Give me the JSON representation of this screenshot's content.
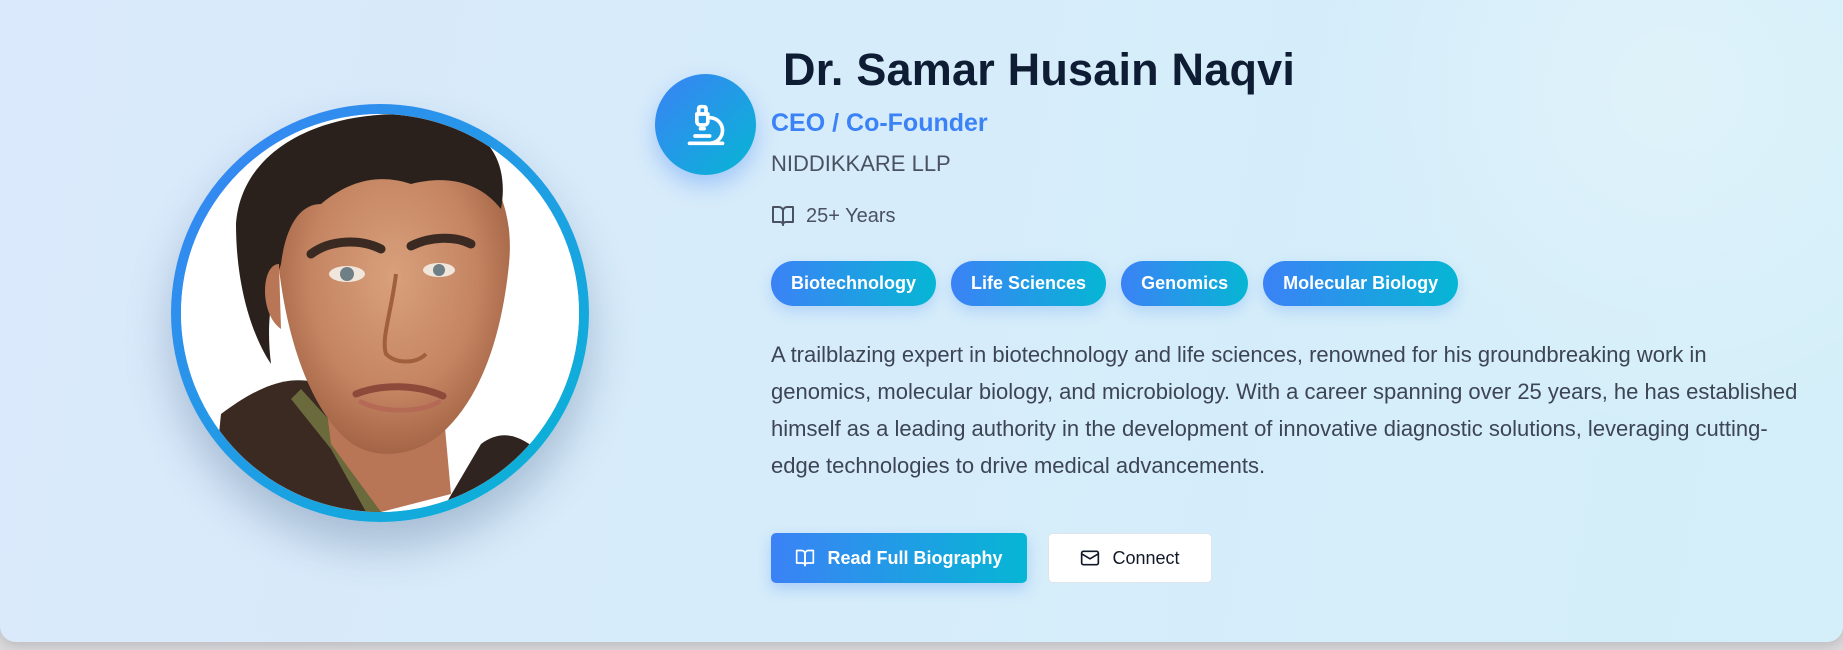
{
  "profile": {
    "name": "Dr. Samar Husain Naqvi",
    "role": "CEO / Co-Founder",
    "organization": "NIDDIKKARE LLP",
    "experience": "25+ Years",
    "tags": [
      "Biotechnology",
      "Life Sciences",
      "Genomics",
      "Molecular Biology"
    ],
    "bio": "A trailblazing expert in biotechnology and life sciences, renowned for his groundbreaking work in genomics, molecular biology, and microbiology. With a career spanning over 25 years, he has established himself as a leading authority in the development of innovative diagnostic solutions, leveraging cutting-edge technologies to drive medical advancements."
  },
  "actions": {
    "read_bio_label": "Read Full Biography",
    "connect_label": "Connect"
  },
  "icons": {
    "badge": "microscope-icon",
    "experience": "book-open-icon",
    "read_bio": "book-open-icon",
    "connect": "mail-icon"
  },
  "colors": {
    "accent_start": "#3b82f6",
    "accent_end": "#06b6d4",
    "name": "#0f1d34",
    "text": "#3d4554"
  }
}
